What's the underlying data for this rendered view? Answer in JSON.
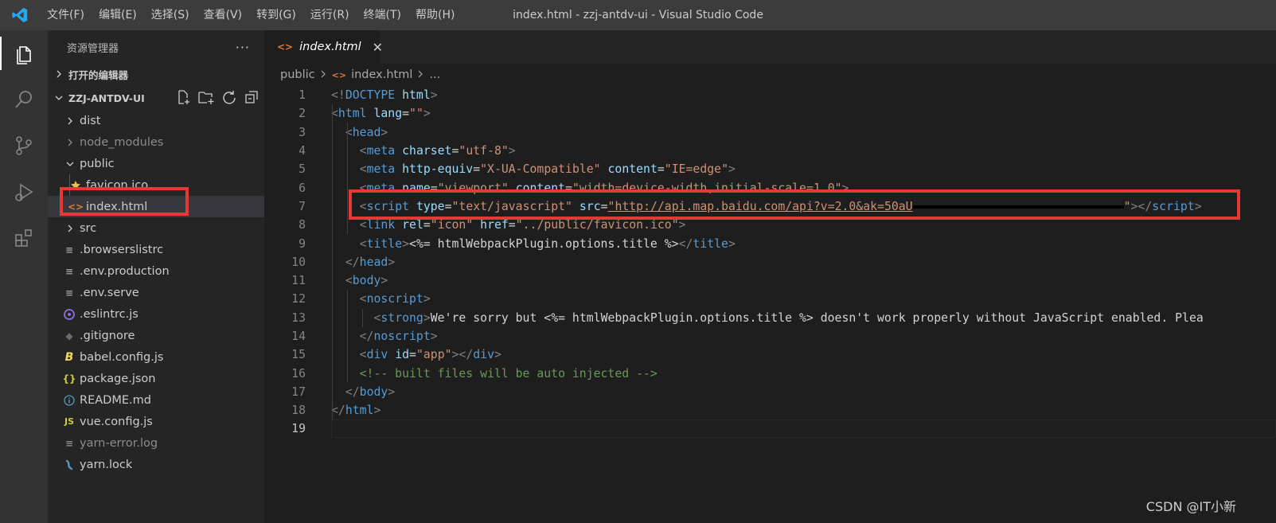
{
  "titlebar": {
    "menu": [
      "文件(F)",
      "编辑(E)",
      "选择(S)",
      "查看(V)",
      "转到(G)",
      "运行(R)",
      "终端(T)",
      "帮助(H)"
    ],
    "window_title": "index.html - zzj-antdv-ui - Visual Studio Code"
  },
  "activitybar": {
    "icons": [
      "explorer-icon",
      "search-icon",
      "source-control-icon",
      "run-debug-icon",
      "extensions-icon"
    ]
  },
  "sidebar": {
    "title": "资源管理器",
    "more": "···",
    "open_editors_label": "打开的编辑器",
    "project_label": "ZZJ-ANTDV-UI",
    "tree": [
      {
        "label": "dist",
        "type": "folder",
        "collapsed": true,
        "depth": 0
      },
      {
        "label": "node_modules",
        "type": "folder",
        "collapsed": true,
        "depth": 0,
        "dim": true
      },
      {
        "label": "public",
        "type": "folder",
        "collapsed": false,
        "depth": 0
      },
      {
        "label": "favicon.ico",
        "type": "file",
        "icon": "star-icon",
        "depth": 1
      },
      {
        "label": "index.html",
        "type": "file",
        "icon": "html-icon",
        "depth": 1,
        "selected": true
      },
      {
        "label": "src",
        "type": "folder",
        "collapsed": true,
        "depth": 0
      },
      {
        "label": ".browserslistrc",
        "type": "file",
        "icon": "lines-icon",
        "depth": 0
      },
      {
        "label": ".env.production",
        "type": "file",
        "icon": "lines-icon",
        "depth": 0
      },
      {
        "label": ".env.serve",
        "type": "file",
        "icon": "lines-icon",
        "depth": 0
      },
      {
        "label": ".eslintrc.js",
        "type": "file",
        "icon": "eslint-icon",
        "depth": 0
      },
      {
        "label": ".gitignore",
        "type": "file",
        "icon": "git-icon",
        "depth": 0
      },
      {
        "label": "babel.config.js",
        "type": "file",
        "icon": "babel-icon",
        "depth": 0
      },
      {
        "label": "package.json",
        "type": "file",
        "icon": "json-icon",
        "depth": 0
      },
      {
        "label": "README.md",
        "type": "file",
        "icon": "info-icon",
        "depth": 0
      },
      {
        "label": "vue.config.js",
        "type": "file",
        "icon": "js-icon",
        "depth": 0
      },
      {
        "label": "yarn-error.log",
        "type": "file",
        "icon": "lines-icon",
        "depth": 0,
        "dim": true
      },
      {
        "label": "yarn.lock",
        "type": "file",
        "icon": "yarn-icon",
        "depth": 0
      }
    ]
  },
  "editor": {
    "tab_label": "index.html",
    "breadcrumb": [
      "public",
      "index.html",
      "..."
    ],
    "current_line": 19,
    "lines": [
      "1",
      "2",
      "3",
      "4",
      "5",
      "6",
      "7",
      "8",
      "9",
      "10",
      "11",
      "12",
      "13",
      "14",
      "15",
      "16",
      "17",
      "18",
      "19"
    ]
  },
  "code_text": {
    "l1": "<!DOCTYPE html>",
    "l2_tag": "html",
    "l2_attr": "lang",
    "l2_val": "\"\"",
    "l3": "head",
    "l4_attr": "charset",
    "l4_val": "\"utf-8\"",
    "l5_attr1": "http-equiv",
    "l5_val1": "\"X-UA-Compatible\"",
    "l5_attr2": "content",
    "l5_val2": "\"IE=edge\"",
    "l6_attr1": "name",
    "l6_val1": "\"viewport\"",
    "l6_attr2": "content",
    "l6_val2": "\"width=device-width,initial-scale=1.0\"",
    "l7_attr1": "type",
    "l7_val1": "\"text/javascript\"",
    "l7_attr2": "src",
    "l7_val2": "\"http://api.map.baidu.com/api?v=2.0&ak=50aU",
    "l8_attr1": "rel",
    "l8_val1": "\"icon\"",
    "l8_attr2": "href",
    "l8_val2": "\"../public/favicon.ico\"",
    "l9_text": "<%= htmlWebpackPlugin.options.title %>",
    "l13_a": "We're sorry but ",
    "l13_b": "<%= htmlWebpackPlugin.options.title %> doesn't work properly without JavaScript enabled. Plea",
    "l15_attr": "id",
    "l15_val": "\"app\"",
    "l16": "<!-- built files will be auto injected -->"
  },
  "watermark": "CSDN @IT小新",
  "colors": {
    "titlebar": "#3c3c3c",
    "activitybar": "#333333",
    "sidebar": "#252526",
    "editor": "#1e1e1e",
    "highlight": "#e53935"
  }
}
